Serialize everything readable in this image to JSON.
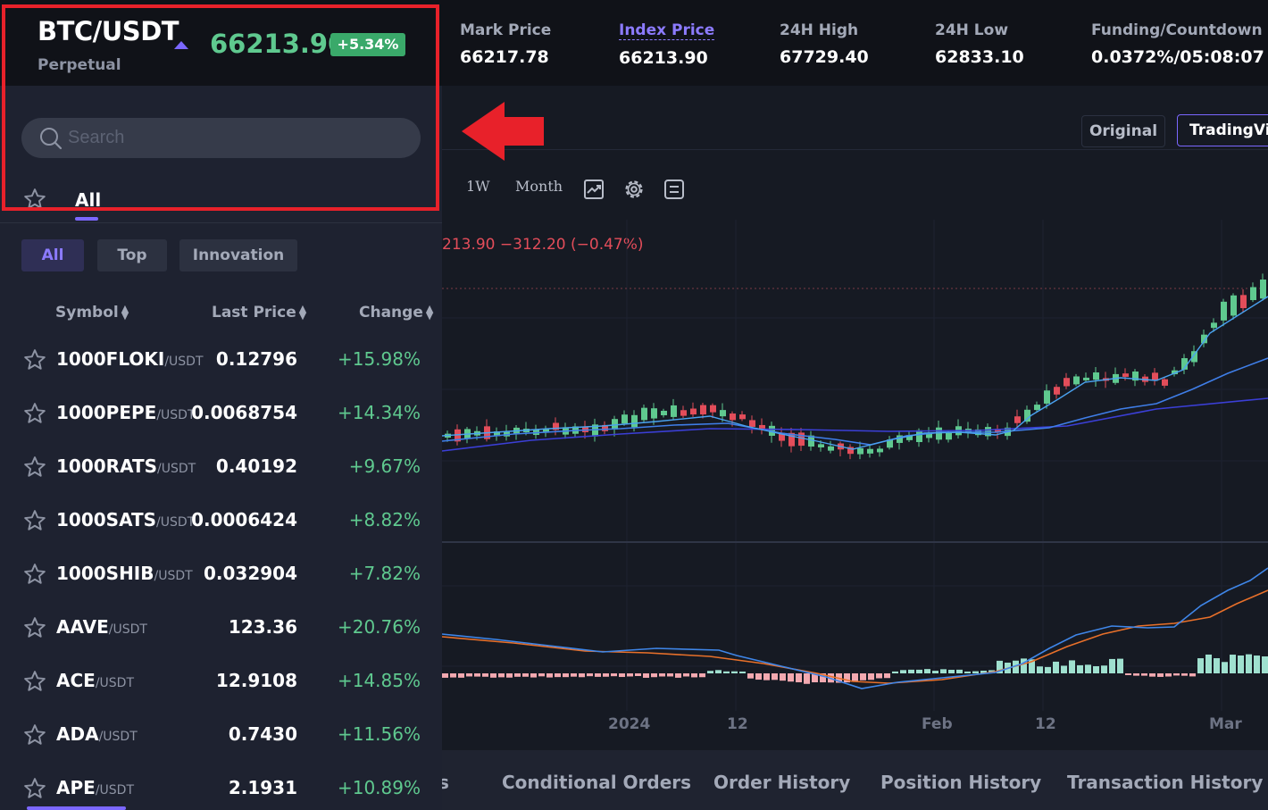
{
  "ticker": {
    "pair": "BTC/USDT",
    "contract_type": "Perpetual",
    "last_price": "66213.90",
    "change_pct": "+5.34%",
    "stats": [
      {
        "label": "Mark Price",
        "value": "66217.78"
      },
      {
        "label": "Index Price",
        "value": "66213.90"
      },
      {
        "label": "24H High",
        "value": "67729.40"
      },
      {
        "label": "24H Low",
        "value": "62833.10"
      },
      {
        "label": "Funding/Countdown",
        "value": "0.0372%/05:08:07"
      }
    ]
  },
  "chart_view": {
    "original_label": "Original",
    "tradingview_label": "TradingView"
  },
  "chart_toolbar": {
    "timeframes": [
      "1W",
      "Month"
    ],
    "icons": [
      "chart-type-icon",
      "settings-icon",
      "indicators-icon"
    ]
  },
  "chart_legend": {
    "ohlc_text": "213.90  −312.20 (−0.47%)"
  },
  "x_axis": [
    "2024",
    "12",
    "Feb",
    "12",
    "Mar"
  ],
  "bottom_tabs": [
    "s",
    "Conditional Orders",
    "Order History",
    "Position History",
    "Transaction History"
  ],
  "dropdown": {
    "search_placeholder": "Search",
    "main_tab": "All",
    "sub_tabs": [
      "All",
      "Top",
      "Innovation"
    ],
    "columns": [
      "Symbol",
      "Last Price",
      "Change"
    ],
    "rows": [
      {
        "base": "1000FLOKI",
        "quote": "/USDT",
        "price": "0.12796",
        "change": "+15.98%"
      },
      {
        "base": "1000PEPE",
        "quote": "/USDT",
        "price": "0.0068754",
        "change": "+14.34%"
      },
      {
        "base": "1000RATS",
        "quote": "/USDT",
        "price": "0.40192",
        "change": "+9.67%"
      },
      {
        "base": "1000SATS",
        "quote": "/USDT",
        "price": "0.0006424",
        "change": "+8.82%"
      },
      {
        "base": "1000SHIB",
        "quote": "/USDT",
        "price": "0.032904",
        "change": "+7.82%"
      },
      {
        "base": "AAVE",
        "quote": "/USDT",
        "price": "123.36",
        "change": "+20.76%"
      },
      {
        "base": "ACE",
        "quote": "/USDT",
        "price": "12.9108",
        "change": "+14.85%"
      },
      {
        "base": "ADA",
        "quote": "/USDT",
        "price": "0.7430",
        "change": "+11.56%"
      },
      {
        "base": "APE",
        "quote": "/USDT",
        "price": "2.1931",
        "change": "+10.89%"
      }
    ]
  },
  "colors": {
    "up": "#5fc98f",
    "down": "#e34d5a",
    "accent": "#7b67ff",
    "highlight": "#e8212a"
  }
}
